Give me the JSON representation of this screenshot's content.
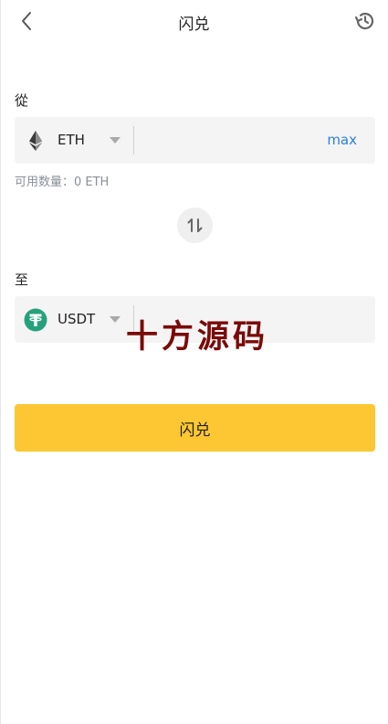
{
  "header": {
    "title": "闪兑"
  },
  "from": {
    "label": "從",
    "token": "ETH",
    "token_icon": "ethereum-icon",
    "amount_value": "",
    "max_label": "max",
    "available_text": "可用数量：0 ETH"
  },
  "to": {
    "label": "至",
    "token": "USDT",
    "token_icon": "tether-icon",
    "amount_value": ""
  },
  "watermark": "十方源码",
  "submit": {
    "label": "闪兑",
    "color": "#fcc733"
  },
  "colors": {
    "accent_link": "#2f7fd8",
    "tether_green": "#26a17b",
    "field_bg": "#f4f4f4"
  }
}
